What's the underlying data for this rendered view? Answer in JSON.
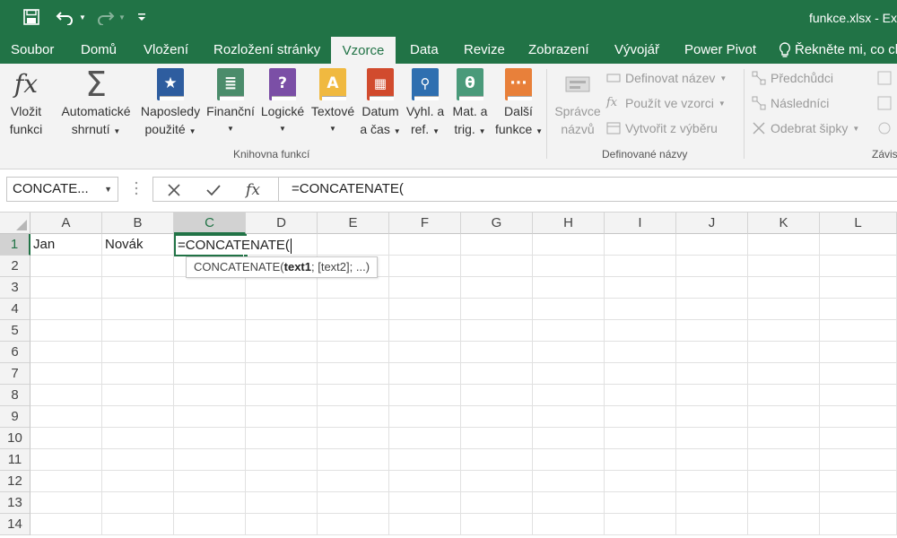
{
  "window": {
    "title": "funkce.xlsx - Ex"
  },
  "colors": {
    "accent": "#217346",
    "ribbon_bg": "#f3f3f3"
  },
  "quick_access": {
    "save_icon": "save-icon",
    "undo_icon": "undo-icon",
    "redo_icon": "redo-icon",
    "customize_icon": "customize-quick-access-icon"
  },
  "tabs": [
    {
      "label": "Soubor"
    },
    {
      "label": "Domů"
    },
    {
      "label": "Vložení"
    },
    {
      "label": "Rozložení stránky"
    },
    {
      "label": "Vzorce",
      "active": true
    },
    {
      "label": "Data"
    },
    {
      "label": "Revize"
    },
    {
      "label": "Zobrazení"
    },
    {
      "label": "Vývojář"
    },
    {
      "label": "Power Pivot"
    }
  ],
  "tell_me": {
    "label": "Řekněte mi, co ch"
  },
  "ribbon": {
    "function_library": {
      "group_label": "Knihovna funkcí",
      "insert_function": {
        "line1": "Vložit",
        "line2": "funkci"
      },
      "autosum": {
        "line1": "Automatické",
        "line2": "shrnutí"
      },
      "recent": {
        "line1": "Naposledy",
        "line2": "použité"
      },
      "financial": {
        "line1": "Finanční"
      },
      "logical": {
        "line1": "Logické"
      },
      "text": {
        "line1": "Textové"
      },
      "datetime": {
        "line1": "Datum",
        "line2": "a čas"
      },
      "lookup": {
        "line1": "Vyhl. a",
        "line2": "ref."
      },
      "math": {
        "line1": "Mat. a",
        "line2": "trig."
      },
      "more": {
        "line1": "Další",
        "line2": "funkce"
      }
    },
    "defined_names": {
      "group_label": "Definované názvy",
      "name_manager": {
        "line1": "Správce",
        "line2": "názvů"
      },
      "define_name": "Definovat název",
      "use_in_formula": "Použít ve vzorci",
      "create_from_selection": "Vytvořit z výběru"
    },
    "formula_auditing": {
      "group_label": "Závis",
      "trace_precedents": "Předchůdci",
      "trace_dependents": "Následníci",
      "remove_arrows": "Odebrat šipky"
    }
  },
  "formula_bar": {
    "name_box": "CONCATE...",
    "formula": "=CONCATENATE("
  },
  "grid": {
    "columns": [
      "A",
      "B",
      "C",
      "D",
      "E",
      "F",
      "G",
      "H",
      "I",
      "J",
      "K",
      "L"
    ],
    "rows": [
      "1",
      "2",
      "3",
      "4",
      "5",
      "6",
      "7",
      "8",
      "9",
      "10",
      "11",
      "12",
      "13",
      "14"
    ],
    "cells": {
      "A1": "Jan",
      "B1": "Novák"
    },
    "editing_cell_text": "=CONCATENATE(",
    "tooltip": {
      "fn": "CONCATENATE(",
      "arg_bold": "text1",
      "rest": "; [text2]; ...)"
    }
  }
}
